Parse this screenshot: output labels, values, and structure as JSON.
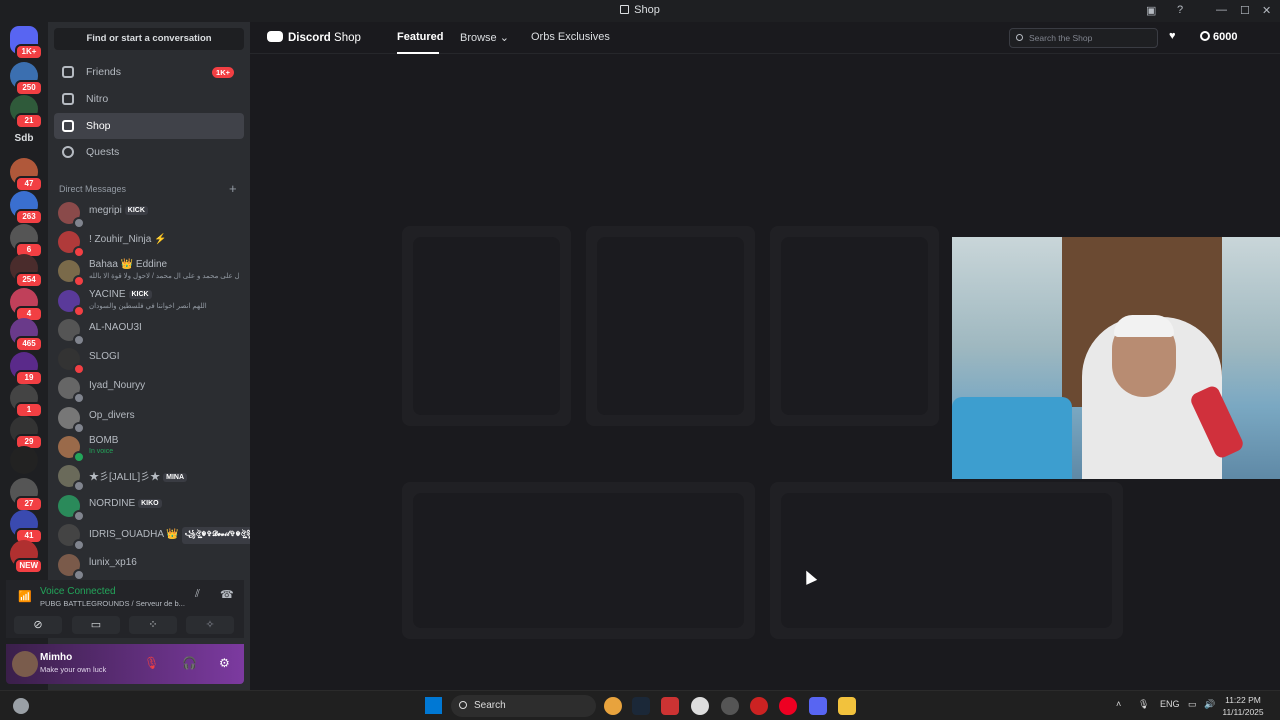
{
  "window": {
    "title": "Shop",
    "controls": [
      "—",
      "☐",
      "✕"
    ]
  },
  "guilds": [
    {
      "badge": "1K+"
    },
    {
      "badge": "250"
    },
    {
      "badge": "21"
    },
    {
      "label": "Sdb",
      "badge": ""
    },
    {
      "badge": "47"
    },
    {
      "badge": "263"
    },
    {
      "badge": "6"
    },
    {
      "badge": "254"
    },
    {
      "badge": "4"
    },
    {
      "badge": "465"
    },
    {
      "badge": "19"
    },
    {
      "badge": "1"
    },
    {
      "badge": "29"
    },
    {
      "badge": ""
    },
    {
      "badge": "27"
    },
    {
      "badge": "41"
    },
    {
      "badge": "NEW"
    }
  ],
  "sidebar": {
    "search_label": "Find or start a conversation",
    "nav": [
      {
        "label": "Friends",
        "badge": "1K+"
      },
      {
        "label": "Nitro",
        "badge": ""
      },
      {
        "label": "Shop",
        "badge": ""
      },
      {
        "label": "Quests",
        "badge": ""
      }
    ],
    "dm_header": "Direct Messages",
    "dm_plus": "+",
    "dms": [
      {
        "name": "megripi",
        "tag": "KICK",
        "sub": ""
      },
      {
        "name": "! Zouhir_Ninja ⚡",
        "tag": "",
        "sub": ""
      },
      {
        "name": "Bahaa 👑 Eddine",
        "tag": "",
        "sub": "صل على محمد و على ال محمد / لاحول ولا قوة الا بالله"
      },
      {
        "name": "YACINE",
        "tag": "KICK",
        "sub": "اللهم انصر اخواننا في فلسطين والسودان"
      },
      {
        "name": "AL-NAOU3I",
        "tag": "",
        "sub": ""
      },
      {
        "name": "SLOGI",
        "tag": "",
        "sub": ""
      },
      {
        "name": "Iyad_Nouryy",
        "tag": "",
        "sub": ""
      },
      {
        "name": "Op_divers",
        "tag": "",
        "sub": ""
      },
      {
        "name": "BOMB",
        "tag": "",
        "sub": "In voice"
      },
      {
        "name": "★彡[JALIL]彡★",
        "tag": "MINA",
        "sub": ""
      },
      {
        "name": "NORDINE",
        "tag": "KIKO",
        "sub": ""
      },
      {
        "name": "IDRIS_OUADHA 👑",
        "tag": "꧁ঔৣ☬✞𝓓𝓮𝓿𝓲𝓵✞☬ঔৣ꧂",
        "sub": ""
      },
      {
        "name": "lunix_xp16",
        "tag": "",
        "sub": ""
      }
    ],
    "voice": {
      "status": "Voice Connected",
      "server": "PUBG BATTLEGROUNDS / Serveur de b..."
    },
    "user": {
      "name": "Mimho",
      "status": "Make your own luck"
    }
  },
  "shop": {
    "logo_brand": "Discord",
    "logo_suffix": "Shop",
    "tabs": [
      "Featured",
      "Browse ⌄",
      "Orbs Exclusives"
    ],
    "search_placeholder": "Search the Shop",
    "orbs": "6000"
  },
  "taskbar": {
    "search_label": "Search",
    "lang": "ENG",
    "time": "11:22 PM",
    "date": "11/11/2025"
  },
  "colors": {
    "accent": "#5865f2",
    "online": "#23a55a",
    "badge": "#f23f43"
  }
}
